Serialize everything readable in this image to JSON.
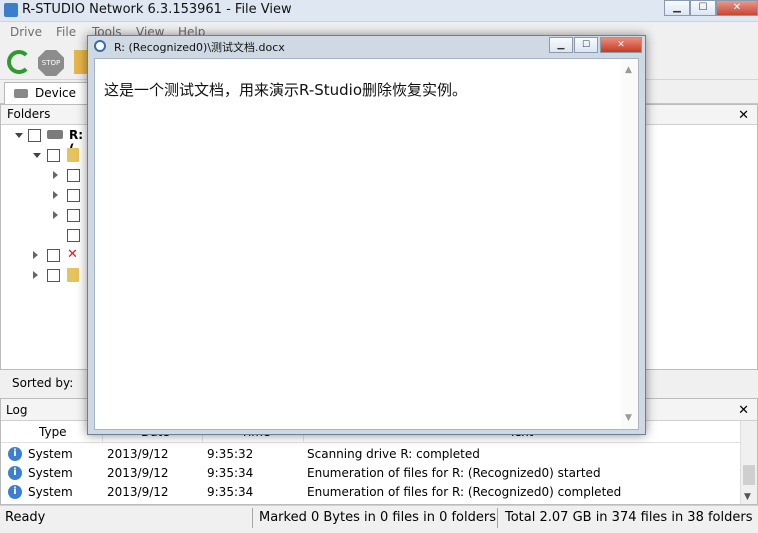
{
  "window": {
    "title": "R-STUDIO Network 6.3.153961 - File View"
  },
  "menu": [
    "Drive",
    "File",
    "Tools",
    "View",
    "Help"
  ],
  "toolbar": {
    "refresh_icon": "refresh-icon",
    "stop_label": "STOP"
  },
  "tabs": {
    "device_view": "Device vie"
  },
  "folders": {
    "header": "Folders",
    "root_label": "R: ("
  },
  "sort": {
    "label": "Sorted by:"
  },
  "log": {
    "header": "Log",
    "columns": [
      "Type",
      "Date",
      "Time",
      "Text"
    ],
    "rows": [
      {
        "type": "System",
        "date": "2013/9/12",
        "time": "9:35:32",
        "text": "Scanning drive R: completed"
      },
      {
        "type": "System",
        "date": "2013/9/12",
        "time": "9:35:34",
        "text": "Enumeration of files for R: (Recognized0) started"
      },
      {
        "type": "System",
        "date": "2013/9/12",
        "time": "9:35:34",
        "text": "Enumeration of files for R: (Recognized0) completed"
      }
    ]
  },
  "status": {
    "ready": "Ready",
    "marked": "Marked 0 Bytes in 0 files in 0 folders",
    "total": "Total 2.07 GB in 374 files in 38 folders"
  },
  "popup": {
    "title": "R: (Recognized0)\\测试文档.docx",
    "content": "这是一个测试文档，用来演示R-Studio删除恢复实例。"
  }
}
